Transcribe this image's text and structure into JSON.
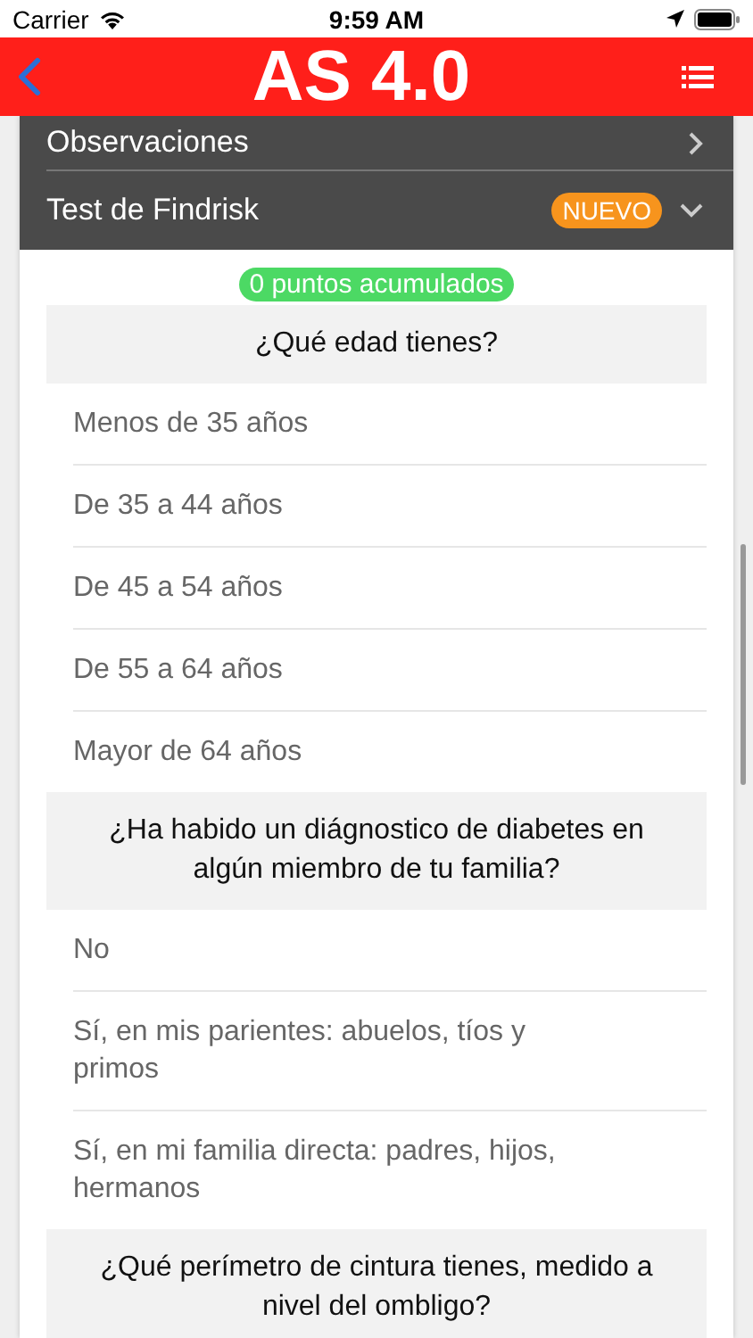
{
  "status_bar": {
    "carrier": "Carrier",
    "time": "9:59 AM"
  },
  "header": {
    "title": "AS 4.0"
  },
  "sections": [
    {
      "label": "Observaciones",
      "expanded": false
    },
    {
      "label": "Test de Findrisk",
      "badge": "NUEVO",
      "expanded": true
    }
  ],
  "score": "0 puntos acumulados",
  "questions": [
    {
      "text": "¿Qué edad tienes?",
      "options": [
        "Menos de 35 años",
        "De 35 a 44 años",
        "De 45 a 54 años",
        "De 55 a 64 años",
        "Mayor de 64 años"
      ]
    },
    {
      "text": "¿Ha habido un diágnostico de diabetes en algún miembro de tu familia?",
      "options": [
        "No",
        "Sí, en mis parientes: abuelos, tíos y primos",
        "Sí, en mi familia directa: padres, hijos, hermanos"
      ]
    },
    {
      "text": "¿Qué perímetro de cintura tienes, medido a nivel del ombligo?"
    }
  ]
}
